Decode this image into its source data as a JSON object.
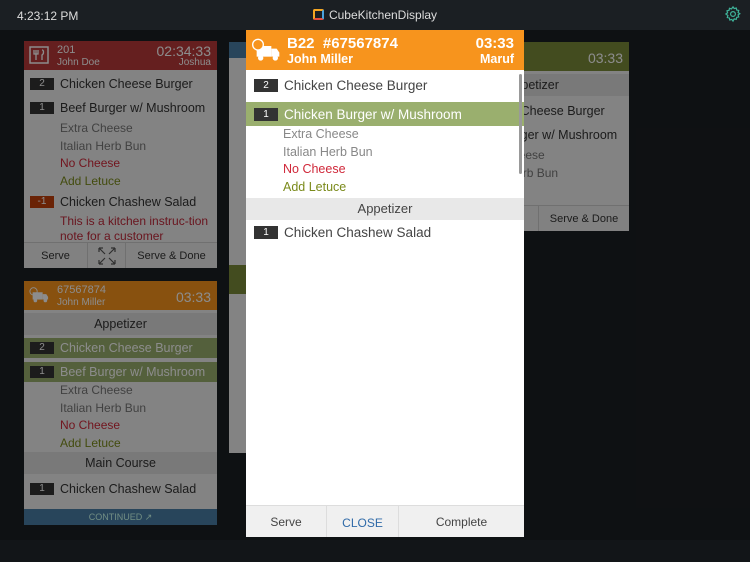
{
  "topbar": {
    "clock": "4:23:12 PM",
    "app_title": "CubeKitchenDisplay",
    "settings_icon": "gear-icon"
  },
  "colors": {
    "dine_in": "#b83a3a",
    "delivery": "#f7941d",
    "takeaway": "#7a8a3a",
    "info": "#4a7fa6",
    "selected": "#9aaf6e"
  },
  "cards": [
    {
      "table": "201",
      "customer": "John Doe",
      "timer": "02:34:33",
      "server": "Joshua",
      "items": [
        {
          "qty": "2",
          "name": "Chicken Cheese Burger"
        },
        {
          "qty": "1",
          "name": "Beef Burger w/ Mushroom"
        },
        {
          "qty": "-1",
          "name": "Chicken Chashew Salad"
        }
      ],
      "modifiers": [
        "Extra Cheese",
        "Italian Herb Bun",
        "No Cheese",
        "Add Letuce"
      ],
      "note": "This is a kitchen instruc-tion note for a customer",
      "serve": "Serve",
      "serve_done": "Serve & Done"
    },
    {
      "order": "67567874",
      "customer": "John Miller",
      "timer": "03:33",
      "section1": "Appetizer",
      "section2": "Main Course",
      "items": [
        {
          "qty": "2",
          "name": "Chicken Cheese Burger"
        },
        {
          "qty": "1",
          "name": "Beef Burger w/ Mushroom"
        },
        {
          "qty": "1",
          "name": "Chicken Chashew Salad"
        }
      ],
      "modifiers": [
        "Extra Cheese",
        "Italian Herb Bun",
        "No Cheese",
        "Add Letuce"
      ],
      "continued": "CONTINUED ↗"
    },
    {
      "timer": "03:33",
      "section": "Appetizer",
      "items": [
        "Chicken Cheese Burger",
        "Beef Burger w/ Mushroom"
      ],
      "modifiers": [
        "Extra Cheese",
        "Italian Herb Bun"
      ],
      "serve_done": "Serve & Done"
    }
  ],
  "modal": {
    "table": "B22",
    "order": "#67567874",
    "customer": "John Miller",
    "timer": "03:33",
    "server": "Maruf",
    "items": [
      {
        "qty": "2",
        "name": "Chicken Cheese Burger"
      },
      {
        "qty": "1",
        "name": "Chicken Burger w/ Mushroom"
      },
      {
        "qty": "1",
        "name": "Chicken Chashew Salad"
      }
    ],
    "modifiers": [
      "Extra Cheese",
      "Italian Herb Bun",
      "No Cheese",
      "Add Letuce"
    ],
    "section": "Appetizer",
    "serve": "Serve",
    "close": "CLOSE",
    "complete": "Complete"
  }
}
